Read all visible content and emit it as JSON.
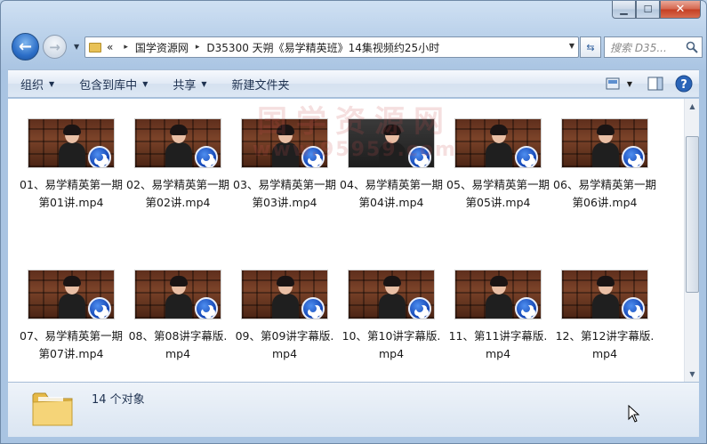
{
  "window": {
    "caption_buttons": {
      "minimize_icon": "minimize-icon",
      "maximize_icon": "maximize-icon",
      "close_icon": "close-icon"
    }
  },
  "nav": {
    "breadcrumb_overflow": "«",
    "breadcrumb": [
      "国学资源网",
      "D35300 天朔《易学精英班》14集视频约25小时"
    ],
    "breadcrumb_separator": "▸",
    "search_placeholder": "搜索 D35..."
  },
  "toolbar": {
    "organize": "组织",
    "include_in_library": "包含到库中",
    "share": "共享",
    "new_folder": "新建文件夹"
  },
  "files": [
    {
      "name": "01、易学精英第一期第01讲.mp4"
    },
    {
      "name": "02、易学精英第一期第02讲.mp4"
    },
    {
      "name": "03、易学精英第一期第03讲.mp4"
    },
    {
      "name": "04、易学精英第一期第04讲.mp4"
    },
    {
      "name": "05、易学精英第一期第05讲.mp4"
    },
    {
      "name": "06、易学精英第一期第06讲.mp4"
    },
    {
      "name": "07、易学精英第一期第07讲.mp4"
    },
    {
      "name": "08、第08讲字幕版.mp4"
    },
    {
      "name": "09、第09讲字幕版.mp4"
    },
    {
      "name": "10、第10讲字幕版.mp4"
    },
    {
      "name": "11、第11讲字幕版.mp4"
    },
    {
      "name": "12、第12讲字幕版.mp4"
    }
  ],
  "watermark": {
    "line1": "国学资源网",
    "line2": "www.95959.com"
  },
  "status": {
    "count": "14 个对象"
  },
  "colors": {
    "accent": "#2c6ec7",
    "play_badge": "#1447b6",
    "watermark": "#c85050"
  }
}
